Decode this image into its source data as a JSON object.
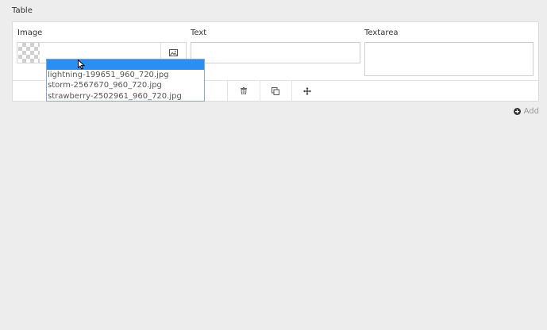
{
  "section": {
    "title": "Table"
  },
  "columns": {
    "image": "Image",
    "text": "Text",
    "textarea": "Textarea"
  },
  "fields": {
    "text_value": "",
    "textarea_value": ""
  },
  "dropdown": {
    "options": [
      "lightning-199651_960_720.jpg",
      "storm-2567670_960_720.jpg",
      "strawberry-2502961_960_720.jpg"
    ]
  },
  "actions": {
    "add_label": "Add"
  },
  "icons": {
    "image_picker": "image-icon",
    "delete": "trash-icon",
    "duplicate": "duplicate-icon",
    "move": "move-icon",
    "add": "plus-circle-icon"
  },
  "colors": {
    "highlight": "#2b8ff2",
    "background": "#ededed"
  }
}
